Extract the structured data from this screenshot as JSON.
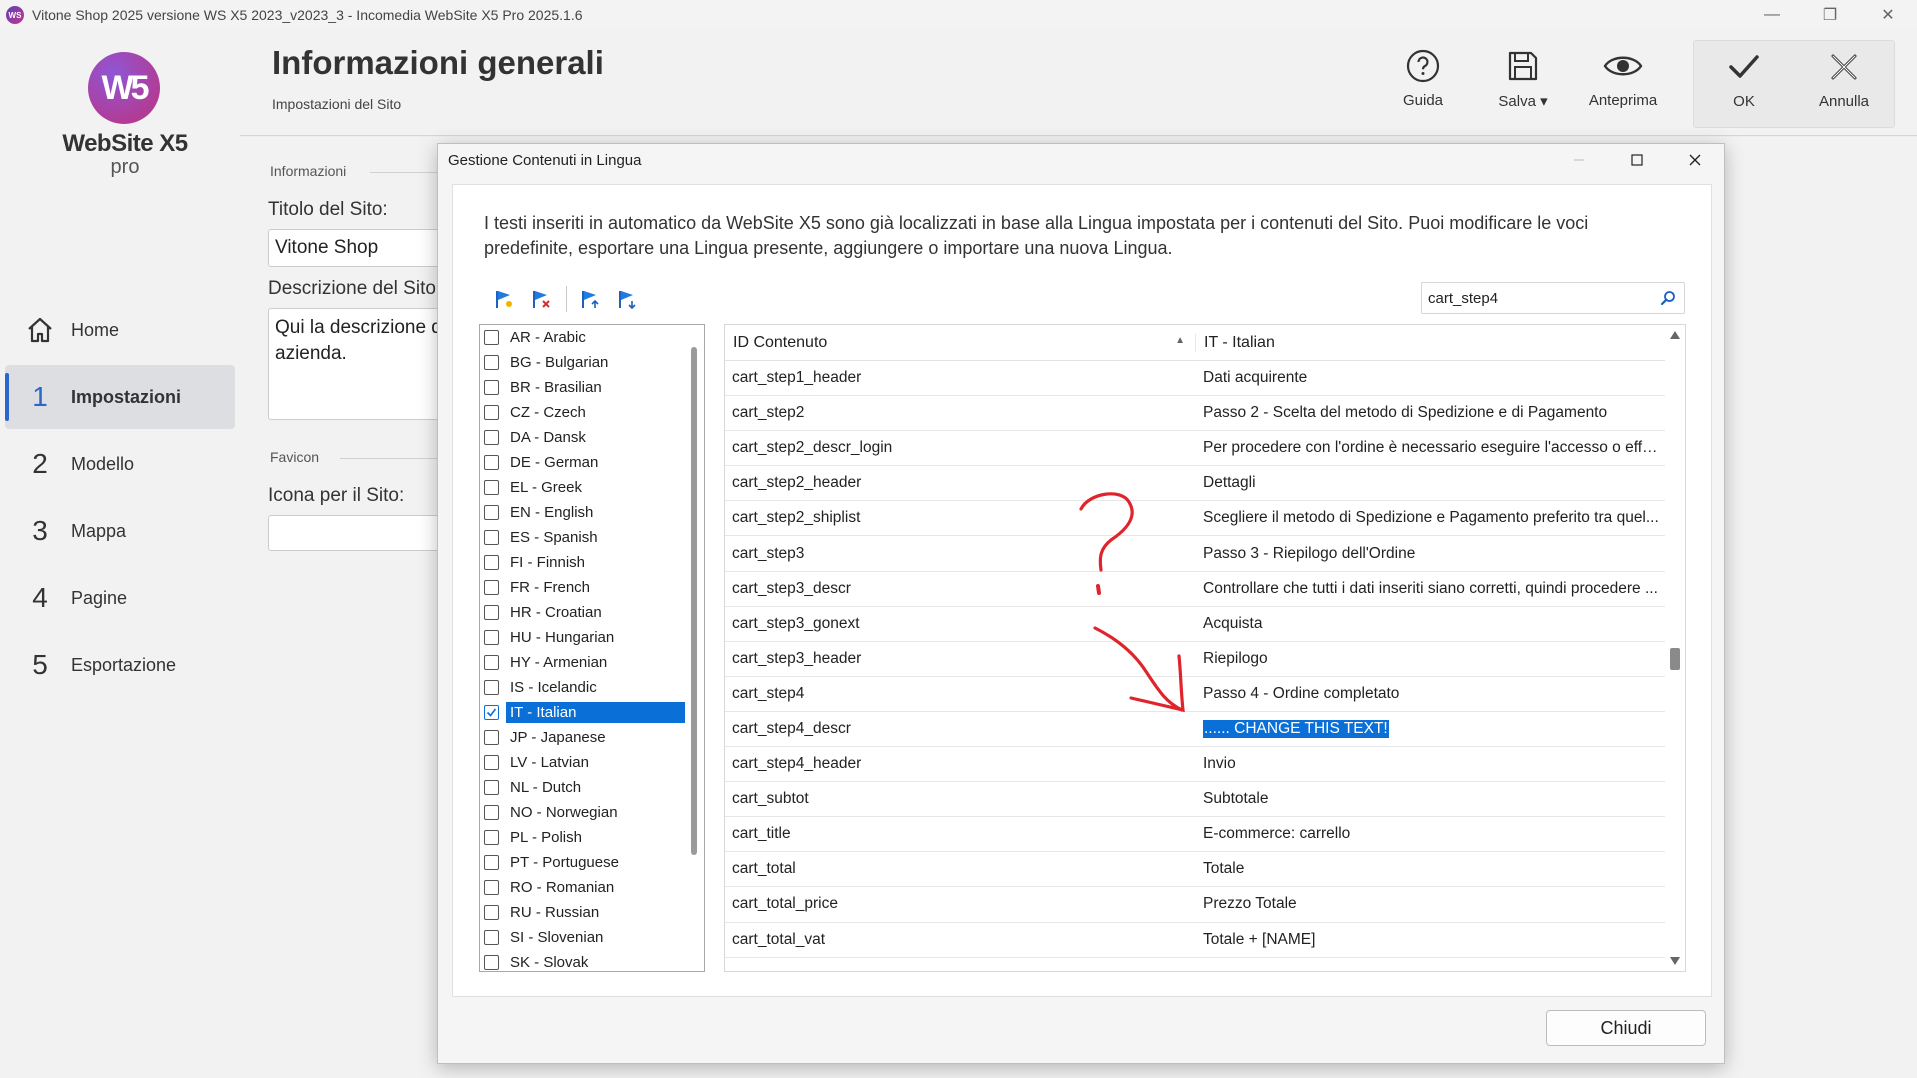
{
  "window": {
    "title": "Vitone Shop 2025 versione WS X5 2023_v2023_3 - Incomedia WebSite X5 Pro 2025.1.6",
    "app_icon_text": "WS",
    "minimize": "—",
    "restore": "❐",
    "close": "✕"
  },
  "logo": {
    "mark": "W5",
    "name": "WebSite X5",
    "edition": "pro"
  },
  "nav": {
    "items": [
      {
        "num": "",
        "label": "Home"
      },
      {
        "num": "1",
        "label": "Impostazioni"
      },
      {
        "num": "2",
        "label": "Modello"
      },
      {
        "num": "3",
        "label": "Mappa"
      },
      {
        "num": "4",
        "label": "Pagine"
      },
      {
        "num": "5",
        "label": "Esportazione"
      }
    ]
  },
  "header": {
    "title": "Informazioni generali",
    "subtitle": "Impostazioni del Sito"
  },
  "toolbar": {
    "guide": "Guida",
    "save": "Salva ▾",
    "preview": "Anteprima",
    "ok": "OK",
    "cancel": "Annulla"
  },
  "form": {
    "section_info": "Informazioni",
    "site_title_label": "Titolo del Sito:",
    "site_title_value": "Vitone Shop",
    "site_desc_label": "Descrizione del Sito:",
    "site_desc_value": "Qui la descrizione della tua azienda.",
    "section_favicon": "Favicon",
    "icon_label": "Icona per il Sito:"
  },
  "dialog": {
    "title": "Gestione Contenuti in Lingua",
    "description": "I testi inseriti in automatico da WebSite X5 sono già localizzati in base alla Lingua impostata per i contenuti del Sito. Puoi modificare le voci predefinite, esportare una Lingua presente, aggiungere o importare una nuova Lingua.",
    "search_value": "cart_step4",
    "close_button": "Chiudi",
    "languages": [
      {
        "label": "AR - Arabic",
        "checked": false
      },
      {
        "label": "BG - Bulgarian",
        "checked": false
      },
      {
        "label": "BR - Brasilian",
        "checked": false
      },
      {
        "label": "CZ - Czech",
        "checked": false
      },
      {
        "label": "DA - Dansk",
        "checked": false
      },
      {
        "label": "DE - German",
        "checked": false
      },
      {
        "label": "EL - Greek",
        "checked": false
      },
      {
        "label": "EN - English",
        "checked": false
      },
      {
        "label": "ES - Spanish",
        "checked": false
      },
      {
        "label": "FI - Finnish",
        "checked": false
      },
      {
        "label": "FR - French",
        "checked": false
      },
      {
        "label": "HR - Croatian",
        "checked": false
      },
      {
        "label": "HU - Hungarian",
        "checked": false
      },
      {
        "label": "HY - Armenian",
        "checked": false
      },
      {
        "label": "IS - Icelandic",
        "checked": false
      },
      {
        "label": "IT - Italian",
        "checked": true
      },
      {
        "label": "JP - Japanese",
        "checked": false
      },
      {
        "label": "LV - Latvian",
        "checked": false
      },
      {
        "label": "NL - Dutch",
        "checked": false
      },
      {
        "label": "NO - Norwegian",
        "checked": false
      },
      {
        "label": "PL - Polish",
        "checked": false
      },
      {
        "label": "PT - Portuguese",
        "checked": false
      },
      {
        "label": "RO - Romanian",
        "checked": false
      },
      {
        "label": "RU - Russian",
        "checked": false
      },
      {
        "label": "SI - Slovenian",
        "checked": false
      },
      {
        "label": "SK - Slovak",
        "checked": false
      }
    ],
    "table": {
      "col1": "ID Contenuto",
      "col2": "IT - Italian",
      "rows": [
        {
          "id": "cart_step1_header",
          "text": "Dati acquirente"
        },
        {
          "id": "cart_step2",
          "text": "Passo 2 - Scelta del metodo di Spedizione e di Pagamento"
        },
        {
          "id": "cart_step2_descr_login",
          "text": "Per procedere con l'ordine è necessario eseguire l'accesso o effet..."
        },
        {
          "id": "cart_step2_header",
          "text": "Dettagli"
        },
        {
          "id": "cart_step2_shiplist",
          "text": "Scegliere il metodo di Spedizione e Pagamento preferito tra quel..."
        },
        {
          "id": "cart_step3",
          "text": "Passo 3 - Riepilogo dell'Ordine"
        },
        {
          "id": "cart_step3_descr",
          "text": "Controllare che tutti i dati inseriti siano corretti, quindi procedere ..."
        },
        {
          "id": "cart_step3_gonext",
          "text": "Acquista"
        },
        {
          "id": "cart_step3_header",
          "text": "Riepilogo"
        },
        {
          "id": "cart_step4",
          "text": "Passo 4 - Ordine completato"
        },
        {
          "id": "cart_step4_descr",
          "text": "...... CHANGE THIS TEXT!",
          "highlight": true
        },
        {
          "id": "cart_step4_header",
          "text": "Invio"
        },
        {
          "id": "cart_subtot",
          "text": "Subtotale"
        },
        {
          "id": "cart_title",
          "text": "E-commerce: carrello"
        },
        {
          "id": "cart_total",
          "text": "Totale"
        },
        {
          "id": "cart_total_price",
          "text": "Prezzo Totale"
        },
        {
          "id": "cart_total_vat",
          "text": "Totale + [NAME]"
        }
      ]
    }
  },
  "colors": {
    "accent": "#2b66c9",
    "selection": "#0a6fd6",
    "annotation": "#e0242b"
  }
}
